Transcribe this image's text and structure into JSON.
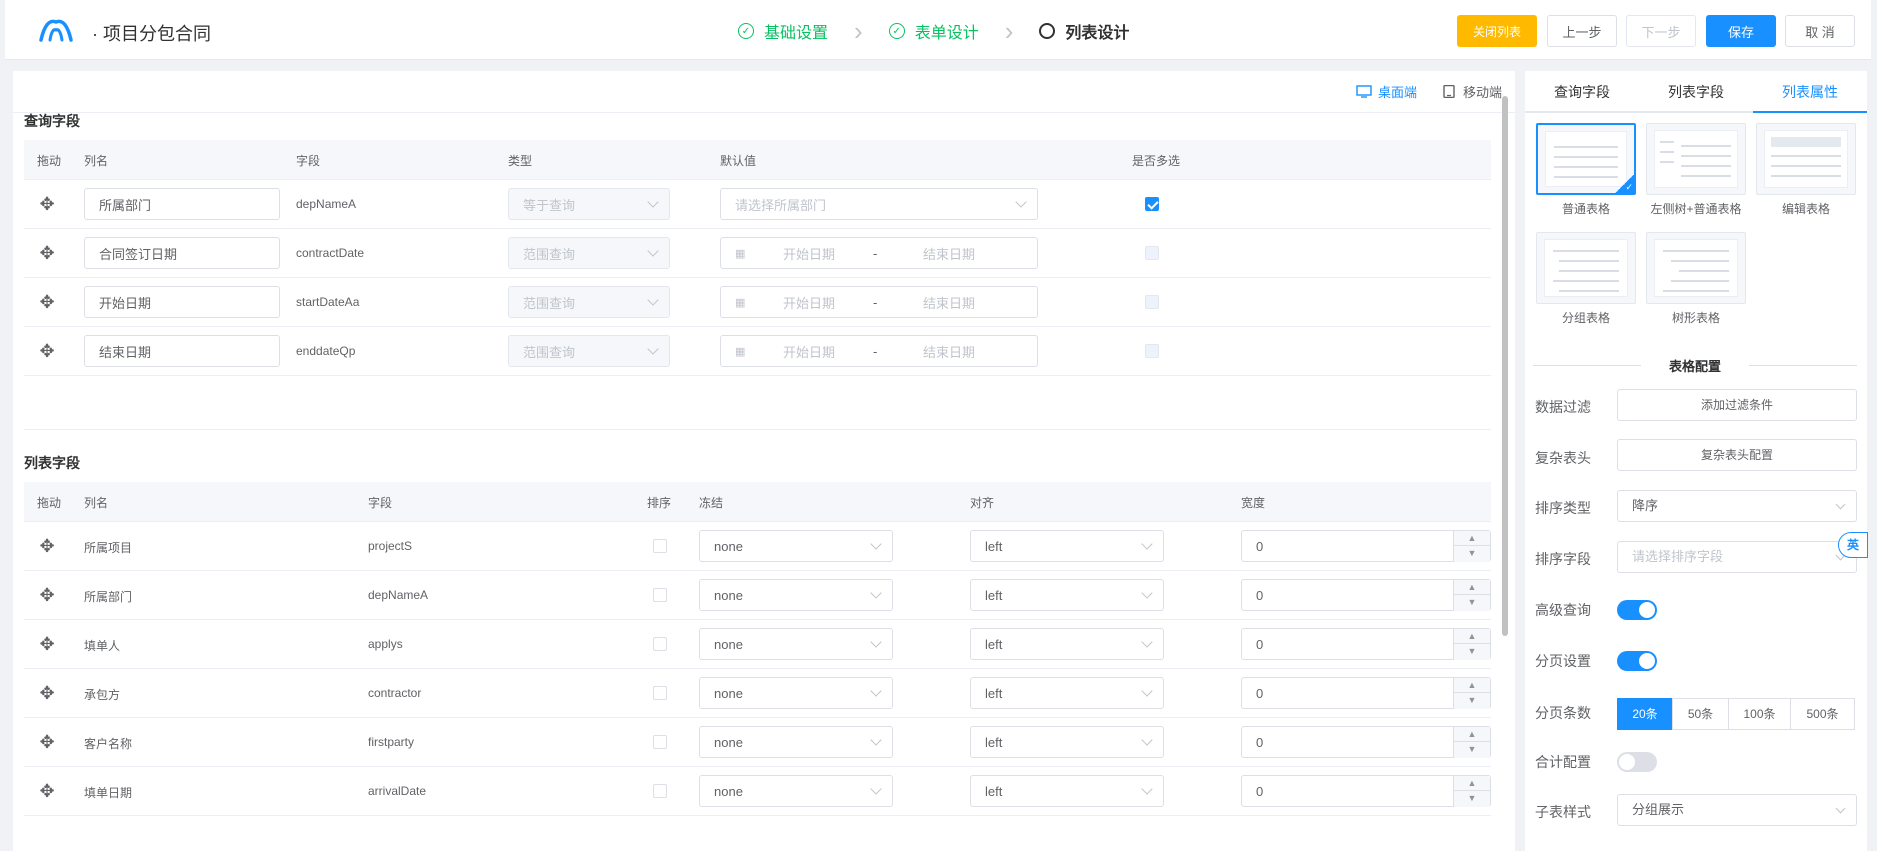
{
  "header": {
    "title": "· 项目分包合同",
    "steps": [
      {
        "label": "基础设置",
        "state": "done"
      },
      {
        "label": "表单设计",
        "state": "done"
      },
      {
        "label": "列表设计",
        "state": "active"
      }
    ],
    "buttons": {
      "close_list": "关闭列表",
      "prev": "上一步",
      "next": "下一步",
      "save": "保存",
      "cancel": "取 消"
    }
  },
  "device": {
    "desktop": "桌面端",
    "mobile": "移动端"
  },
  "query": {
    "title": "查询字段",
    "headers": {
      "drag": "拖动",
      "col": "列名",
      "field": "字段",
      "type": "类型",
      "default": "默认值",
      "multi": "是否多选"
    },
    "rows": [
      {
        "name": "所属部门",
        "field": "depNameA",
        "type": "等于查询",
        "default_placeholder": "请选择所属部门",
        "multi": true
      },
      {
        "name": "合同签订日期",
        "field": "contractDate",
        "type": "范围查询",
        "start": "开始日期",
        "sep": "-",
        "end": "结束日期",
        "multi": false
      },
      {
        "name": "开始日期",
        "field": "startDateAa",
        "type": "范围查询",
        "start": "开始日期",
        "sep": "-",
        "end": "结束日期",
        "multi": false
      },
      {
        "name": "结束日期",
        "field": "enddateQp",
        "type": "范围查询",
        "start": "开始日期",
        "sep": "-",
        "end": "结束日期",
        "multi": false
      }
    ]
  },
  "list": {
    "title": "列表字段",
    "headers": {
      "drag": "拖动",
      "col": "列名",
      "field": "字段",
      "sort": "排序",
      "freeze": "冻结",
      "align": "对齐",
      "width": "宽度"
    },
    "rows": [
      {
        "name": "所属项目",
        "field": "projectS",
        "freeze": "none",
        "align": "left",
        "width": "0"
      },
      {
        "name": "所属部门",
        "field": "depNameA",
        "freeze": "none",
        "align": "left",
        "width": "0"
      },
      {
        "name": "填单人",
        "field": "applys",
        "freeze": "none",
        "align": "left",
        "width": "0"
      },
      {
        "name": "承包方",
        "field": "contractor",
        "freeze": "none",
        "align": "left",
        "width": "0"
      },
      {
        "name": "客户名称",
        "field": "firstparty",
        "freeze": "none",
        "align": "left",
        "width": "0"
      },
      {
        "name": "填单日期",
        "field": "arrivalDate",
        "freeze": "none",
        "align": "left",
        "width": "0"
      }
    ]
  },
  "side": {
    "tabs": [
      "查询字段",
      "列表字段",
      "列表属性"
    ],
    "layouts": [
      "普通表格",
      "左侧树+普通表格",
      "编辑表格",
      "分组表格",
      "树形表格"
    ],
    "config_title": "表格配置",
    "filter_label": "数据过滤",
    "filter_btn": "添加过滤条件",
    "header_label": "复杂表头",
    "header_btn": "复杂表头配置",
    "sort_type_label": "排序类型",
    "sort_type": "降序",
    "sort_field_label": "排序字段",
    "sort_field_placeholder": "请选择排序字段",
    "adv_label": "高级查询",
    "adv_on": true,
    "page_label": "分页设置",
    "page_on": true,
    "page_size_label": "分页条数",
    "page_sizes": [
      "20条",
      "50条",
      "100条",
      "500条"
    ],
    "sum_label": "合计配置",
    "sum_on": false,
    "child_label": "子表样式",
    "child_style": "分组展示"
  },
  "lang_badge": "英"
}
